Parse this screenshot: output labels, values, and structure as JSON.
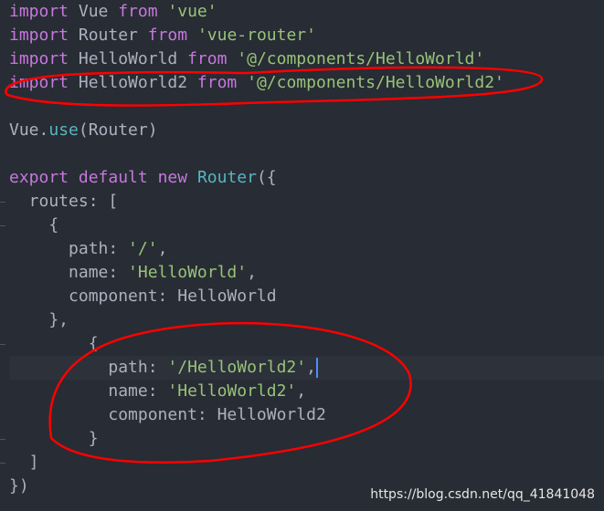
{
  "editor": {
    "lines": [
      [
        [
          "kw",
          "import"
        ],
        [
          "plain",
          " Vue "
        ],
        [
          "kw",
          "from"
        ],
        [
          "plain",
          " "
        ],
        [
          "str",
          "'vue'"
        ]
      ],
      [
        [
          "kw",
          "import"
        ],
        [
          "plain",
          " Router "
        ],
        [
          "kw",
          "from"
        ],
        [
          "plain",
          " "
        ],
        [
          "str",
          "'vue-router'"
        ]
      ],
      [
        [
          "kw",
          "import"
        ],
        [
          "plain",
          " HelloWorld "
        ],
        [
          "kw",
          "from"
        ],
        [
          "plain",
          " "
        ],
        [
          "str",
          "'@/components/HelloWorld'"
        ]
      ],
      [
        [
          "kw",
          "import"
        ],
        [
          "plain",
          " HelloWorld2 "
        ],
        [
          "kw",
          "from"
        ],
        [
          "plain",
          " "
        ],
        [
          "str",
          "'@/components/HelloWorld2'"
        ]
      ],
      [],
      [
        [
          "plain",
          "Vue."
        ],
        [
          "fn",
          "use"
        ],
        [
          "plain",
          "(Router)"
        ]
      ],
      [],
      [
        [
          "kw",
          "export"
        ],
        [
          "plain",
          " "
        ],
        [
          "kw",
          "default"
        ],
        [
          "plain",
          " "
        ],
        [
          "kw",
          "new"
        ],
        [
          "plain",
          " "
        ],
        [
          "fn",
          "Router"
        ],
        [
          "plain",
          "({"
        ]
      ],
      [
        [
          "plain",
          "  routes: ["
        ]
      ],
      [
        [
          "plain",
          "    {"
        ]
      ],
      [
        [
          "plain",
          "      path: "
        ],
        [
          "str",
          "'/'"
        ],
        [
          "plain",
          ","
        ]
      ],
      [
        [
          "plain",
          "      name: "
        ],
        [
          "str",
          "'HelloWorld'"
        ],
        [
          "plain",
          ","
        ]
      ],
      [
        [
          "plain",
          "      component: HelloWorld"
        ]
      ],
      [
        [
          "plain",
          "    },"
        ]
      ],
      [
        [
          "plain",
          "        {"
        ]
      ],
      [
        [
          "plain",
          "          path: "
        ],
        [
          "str",
          "'/HelloWorld2'"
        ],
        [
          "plain",
          ","
        ]
      ],
      [
        [
          "plain",
          "          name: "
        ],
        [
          "str",
          "'HelloWorld2'"
        ],
        [
          "plain",
          ","
        ]
      ],
      [
        [
          "plain",
          "          component: HelloWorld2"
        ]
      ],
      [
        [
          "plain",
          "        }"
        ]
      ],
      [
        [
          "plain",
          "  ]"
        ]
      ],
      [
        [
          "plain",
          "})"
        ]
      ]
    ],
    "active_line": 16,
    "colors": {
      "background": "#282c34",
      "keyword": "#c678dd",
      "string": "#98c379",
      "function": "#56b6c2",
      "text": "#abb2bf",
      "annotation": "#ff0000"
    }
  },
  "watermark": "https://blog.csdn.net/qq_41841048"
}
